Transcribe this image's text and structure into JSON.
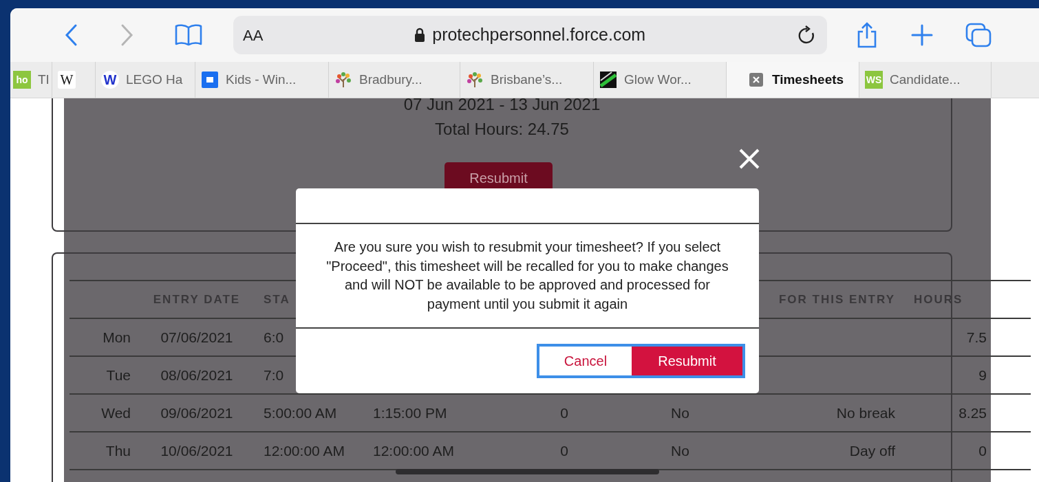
{
  "toolbar": {
    "text_size_button": "AA",
    "url": "protechpersonnel.force.com"
  },
  "tabs": [
    {
      "label": "TI",
      "selected": false,
      "icon": {
        "kind": "letters",
        "text": "ho",
        "color": "#8dc63f"
      }
    },
    {
      "selected": false,
      "icon": {
        "kind": "serif",
        "text": "W",
        "color": "#ffffff"
      }
    },
    {
      "label": "LEGO Ha",
      "selected": false,
      "icon": {
        "kind": "round",
        "text": "W",
        "color": "#ffffff"
      }
    },
    {
      "label": "Kids - Win...",
      "selected": false,
      "icon": {
        "kind": "square"
      }
    },
    {
      "label": "Bradbury...",
      "selected": false,
      "icon": {
        "kind": "tree"
      }
    },
    {
      "label": "Brisbane’s...",
      "selected": false,
      "icon": {
        "kind": "tree"
      }
    },
    {
      "label": "Glow Wor...",
      "selected": false,
      "icon": {
        "kind": "stripe"
      }
    },
    {
      "label": "Timesheets",
      "selected": true,
      "icon": {
        "kind": "close"
      }
    },
    {
      "label": "Candidate...",
      "selected": false,
      "icon": {
        "kind": "letters",
        "text": "WS",
        "color": "#8cc63f"
      }
    }
  ],
  "summary": {
    "period": "07 Jun 2021 - 13 Jun 2021",
    "total_hours": "Total Hours: 24.75",
    "button": "Resubmit"
  },
  "table": {
    "header": {
      "entry_date": "ENTRY DATE",
      "column_3": "STA",
      "column_7": "FOR THIS ENTRY",
      "hours": "HOURS"
    },
    "rows": [
      {
        "column_1": "Mon",
        "entry_date": "07/06/2021",
        "column_3": "6:0",
        "hours": "7.5"
      },
      {
        "column_1": "Tue",
        "entry_date": "08/06/2021",
        "column_3": "7:0",
        "hours": "9"
      },
      {
        "column_1": "Wed",
        "entry_date": "09/06/2021",
        "column_3": "5:00:00 AM",
        "column_4": "1:15:00 PM",
        "column_5": "0",
        "column_6": "No",
        "column_7": "No break",
        "hours": "8.25"
      },
      {
        "column_1": "Thu",
        "entry_date": "10/06/2021",
        "column_3": "12:00:00 AM",
        "column_4": "12:00:00 AM",
        "column_5": "0",
        "column_6": "No",
        "column_7": "Day off",
        "hours": "0"
      }
    ]
  },
  "dialog": {
    "message": "Are you sure you wish to resubmit your timesheet? If you select \"Proceed\", this timesheet will be recalled for you to make changes and will NOT be available to be approved and processed for payment until you submit it again",
    "buttons": [
      {
        "label": "Cancel",
        "kind": "secondary"
      },
      {
        "label": "Resubmit",
        "kind": "primary"
      }
    ]
  }
}
